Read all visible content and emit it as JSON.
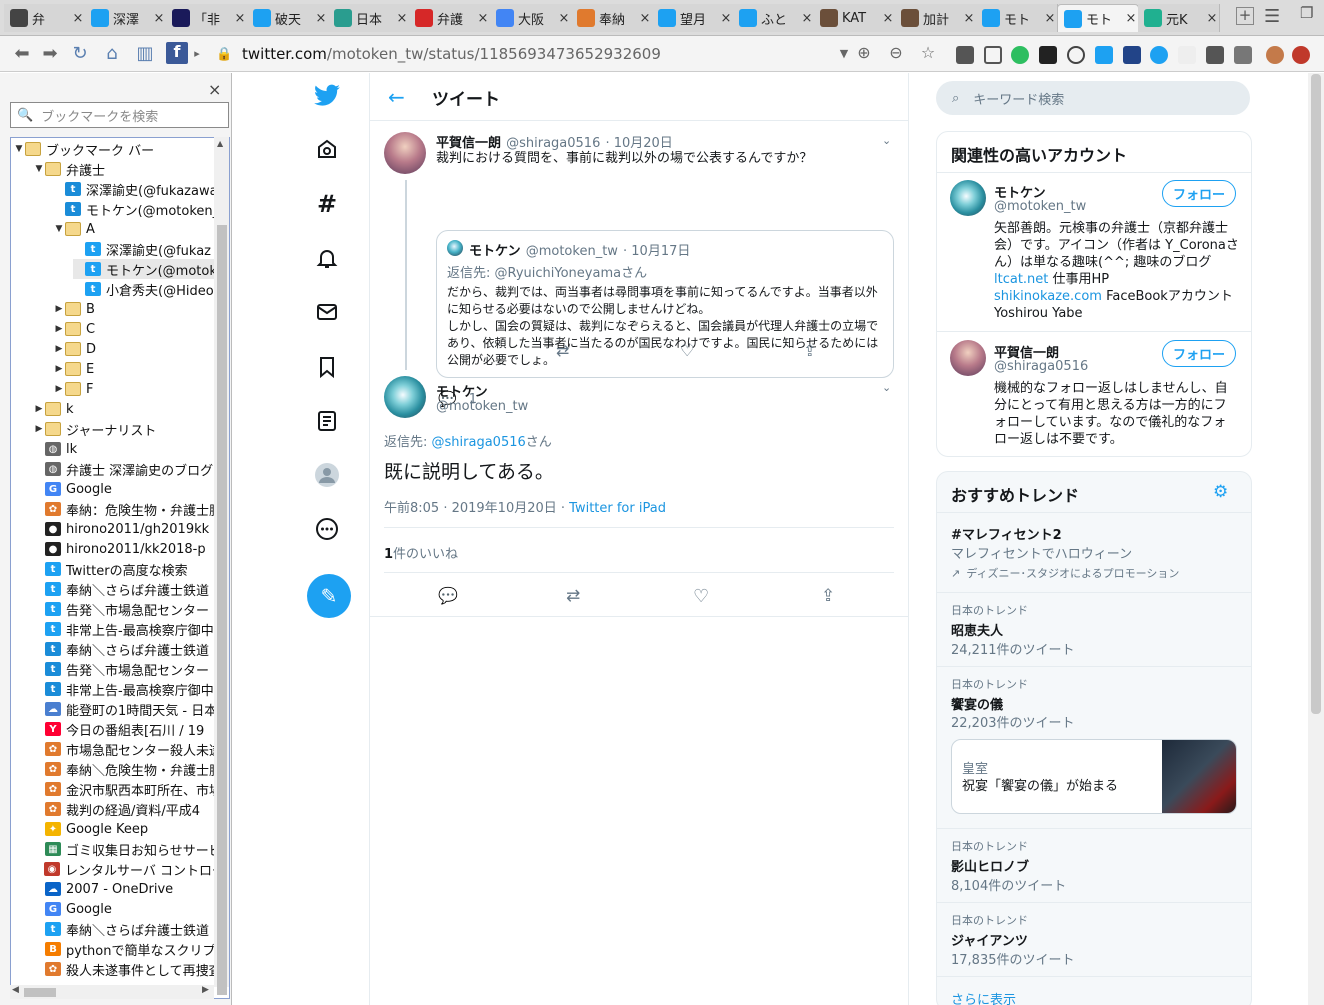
{
  "browser": {
    "tabs": [
      {
        "label": "弁",
        "icon": "panda-icon",
        "color": "#444444"
      },
      {
        "label": "深澤",
        "icon": "twitter-icon",
        "color": "#1da1f2"
      },
      {
        "label": "「非",
        "icon": "nhk-icon",
        "color": "#1a1a5a"
      },
      {
        "label": "破天",
        "icon": "twitter-icon",
        "color": "#1da1f2"
      },
      {
        "label": "日本",
        "icon": "bookmark-site-icon",
        "color": "#2a9d8f"
      },
      {
        "label": "弁護",
        "icon": "red-logo-icon",
        "color": "#d62828"
      },
      {
        "label": "大阪",
        "icon": "google-icon",
        "color": "#4285f4"
      },
      {
        "label": "奉納",
        "icon": "octopus-icon",
        "color": "#e07a2e"
      },
      {
        "label": "望月",
        "icon": "twitter-icon",
        "color": "#1da1f2"
      },
      {
        "label": "ふと",
        "icon": "twitter-icon",
        "color": "#1da1f2"
      },
      {
        "label": "KAT",
        "icon": "kanji-site-icon",
        "color": "#6b4f3a"
      },
      {
        "label": "加計",
        "icon": "kanji-site-icon",
        "color": "#6b4f3a"
      },
      {
        "label": "モト",
        "icon": "twitter-icon",
        "color": "#1da1f2"
      },
      {
        "label": "モト",
        "icon": "twitter-icon",
        "color": "#1da1f2",
        "active": true
      },
      {
        "label": "元K",
        "icon": "green-logo-icon",
        "color": "#20b090"
      }
    ],
    "url_host": "twitter.com",
    "url_path": "/motoken_tw/status/1185693473652932609"
  },
  "sidebar": {
    "search_placeholder": "ブックマークを検索",
    "close": "×",
    "items": [
      {
        "label": "ブックマーク バー",
        "level": 0,
        "type": "folder",
        "open": true
      },
      {
        "label": "弁護士",
        "level": 1,
        "type": "folder",
        "open": true
      },
      {
        "label": "深澤諭史(@fukazawa",
        "level": 2,
        "type": "tw-old"
      },
      {
        "label": "モトケン(@motoken_",
        "level": 2,
        "type": "tw-old"
      },
      {
        "label": "A",
        "level": 2,
        "type": "folder",
        "open": true
      },
      {
        "label": "深澤諭史(@fukaz",
        "level": 3,
        "type": "tw"
      },
      {
        "label": "モトケン(@motoke",
        "level": 3,
        "type": "tw"
      },
      {
        "label": "小倉秀夫(@Hideo",
        "level": 3,
        "type": "tw"
      },
      {
        "label": "B",
        "level": 2,
        "type": "folder"
      },
      {
        "label": "C",
        "level": 2,
        "type": "folder"
      },
      {
        "label": "D",
        "level": 2,
        "type": "folder"
      },
      {
        "label": "E",
        "level": 2,
        "type": "folder"
      },
      {
        "label": "F",
        "level": 2,
        "type": "folder"
      },
      {
        "label": "k",
        "level": 1,
        "type": "folder"
      },
      {
        "label": "ジャーナリスト",
        "level": 1,
        "type": "folder"
      },
      {
        "label": "lk",
        "level": 1,
        "type": "globe"
      },
      {
        "label": "弁護士 深澤諭史のブログ",
        "level": 1,
        "type": "globe"
      },
      {
        "label": "Google",
        "level": 1,
        "type": "google"
      },
      {
        "label": "奉納：危険生物・弁護士脳",
        "level": 1,
        "type": "octo"
      },
      {
        "label": "hirono2011/gh2019kk",
        "level": 1,
        "type": "github"
      },
      {
        "label": "hirono2011/kk2018-p",
        "level": 1,
        "type": "github"
      },
      {
        "label": "Twitterの高度な検索",
        "level": 1,
        "type": "tw"
      },
      {
        "label": "奉納＼さらば弁護士鉄道",
        "level": 1,
        "type": "tw"
      },
      {
        "label": "告発＼市場急配センター",
        "level": 1,
        "type": "tw"
      },
      {
        "label": "非常上告-最高検察庁御中",
        "level": 1,
        "type": "tw"
      },
      {
        "label": "奉納＼さらば弁護士鉄道",
        "level": 1,
        "type": "tw-old"
      },
      {
        "label": "告発＼市場急配センター",
        "level": 1,
        "type": "tw-old"
      },
      {
        "label": "非常上告-最高検察庁御中",
        "level": 1,
        "type": "tw-old"
      },
      {
        "label": "能登町の1時間天気 - 日本",
        "level": 1,
        "type": "weather"
      },
      {
        "label": "今日の番組表[石川 / 19",
        "level": 1,
        "type": "yahoo"
      },
      {
        "label": "市場急配センター殺人未遂",
        "level": 1,
        "type": "octo"
      },
      {
        "label": "奉納＼危険生物・弁護士脳",
        "level": 1,
        "type": "octo"
      },
      {
        "label": "金沢市駅西本町所在、市場",
        "level": 1,
        "type": "octo"
      },
      {
        "label": "裁判の経過/資料/平成4",
        "level": 1,
        "type": "octo"
      },
      {
        "label": "Google Keep",
        "level": 1,
        "type": "keep"
      },
      {
        "label": "ゴミ収集日お知らせサービス",
        "level": 1,
        "type": "gomi"
      },
      {
        "label": "レンタルサーバ コントロール",
        "level": 1,
        "type": "server"
      },
      {
        "label": "2007 - OneDrive",
        "level": 1,
        "type": "onedrive"
      },
      {
        "label": "Google",
        "level": 1,
        "type": "google"
      },
      {
        "label": "奉納＼さらば弁護士鉄道",
        "level": 1,
        "type": "tw"
      },
      {
        "label": "pythonで簡単なスクリプト",
        "level": 1,
        "type": "blogger"
      },
      {
        "label": "殺人未遂事件として再捜査",
        "level": 1,
        "type": "octo"
      }
    ]
  },
  "twitter": {
    "header_title": "ツイート",
    "parent": {
      "name": "平賀信一朗",
      "handle": "@shiraga0516",
      "date": "· 10月20日",
      "text": "裁判における質問を、事前に裁判以外の場で公表するんですか？",
      "quote": {
        "name": "モトケン",
        "handle": "@motoken_tw",
        "date": "· 10月17日",
        "reply_to_label": "返信先: ",
        "reply_to_handle": "@RyuichiYoneyama",
        "reply_to_suffix": "さん",
        "text1": "だから、裁判では、両当事者は尋問事項を事前に知ってるんですよ。当事者以外に知らせる必要はないので公開しませんけどね。",
        "text2": "しかし、国会の質疑は、裁判になぞらえると、国会議員が代理人弁護士の立場であり、依頼した当事者に当たるのが国民なわけですよ。国民に知らせるためには公開が必要でしょ。"
      },
      "reply_count": "1"
    },
    "main": {
      "name": "モトケン",
      "handle": "@motoken_tw",
      "reply_to_label": "返信先: ",
      "reply_to_handle": "@shiraga0516",
      "reply_to_suffix": "さん",
      "text": "既に説明してある。",
      "time": "午前8:05 · 2019年10月20日 · ",
      "source": "Twitter for iPad",
      "likes_count": "1",
      "likes_label": "件のいいね"
    },
    "search_placeholder": "キーワード検索",
    "related": {
      "title": "関連性の高いアカウント",
      "follow_label": "フォロー",
      "accounts": [
        {
          "name": "モトケン",
          "handle": "@motoken_tw",
          "bio1": "矢部善朗。元検事の弁護士（京都弁護士会）です。アイコン（作者は Y_Coronaさん）は単なる趣味(^^; 趣味のブログ",
          "link1": "ltcat.net",
          "bio2": " 仕事用HP",
          "link2": "shikinokaze.com",
          "bio3": " FaceBookアカウント Yoshirou Yabe"
        },
        {
          "name": "平賀信一朗",
          "handle": "@shiraga0516",
          "bio1": "機械的なフォロー返しはしませんし、自分にとって有用と思える方は一方的にフォローしています。なので儀礼的なフォロー返しは不要です。"
        }
      ]
    },
    "trends": {
      "title": "おすすめトレンド",
      "promoted": {
        "name": "#マレフィセント2",
        "desc": "マレフィセントでハロウィーン",
        "promo": "ディズニー･スタジオによるプロモーション"
      },
      "items": [
        {
          "sub": "日本のトレンド",
          "name": "昭恵夫人",
          "count": "24,211件のツイート"
        },
        {
          "sub": "日本のトレンド",
          "name": "饗宴の儀",
          "count": "22,203件のツイート"
        },
        {
          "sub": "日本のトレンド",
          "name": "影山ヒロノブ",
          "count": "8,104件のツイート"
        },
        {
          "sub": "日本のトレンド",
          "name": "ジャイアンツ",
          "count": "17,835件のツイート"
        }
      ],
      "news": {
        "category": "皇室",
        "headline": "祝宴「饗宴の儀」が始まる"
      },
      "show_more": "さらに表示"
    }
  }
}
